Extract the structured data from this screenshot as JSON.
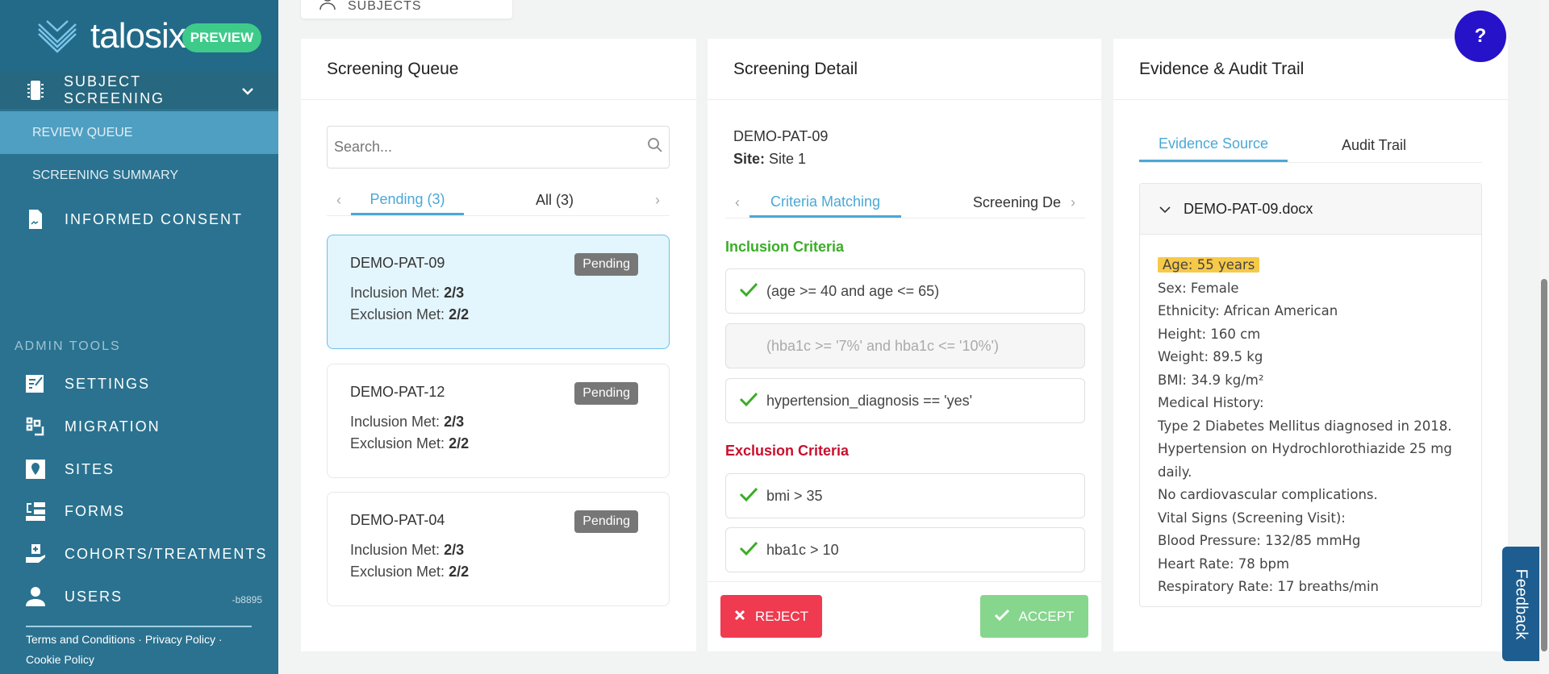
{
  "brand": {
    "name": "talosix",
    "badge": "PREVIEW"
  },
  "sidebar": {
    "subject_screening": "SUBJECT SCREENING",
    "sub_items": [
      "REVIEW QUEUE",
      "SCREENING SUMMARY"
    ],
    "informed_consent": "INFORMED CONSENT",
    "admin_title": "ADMIN TOOLS",
    "admin_items": [
      "SETTINGS",
      "MIGRATION",
      "SITES",
      "FORMS",
      "COHORTS/TREATMENTS",
      "USERS"
    ],
    "version": "-b8895",
    "footer": {
      "terms": "Terms and Conditions",
      "privacy": "Privacy Policy",
      "cookie": "Cookie Policy",
      "sep": "·"
    }
  },
  "top": {
    "bulk_import": "BULK IMPORT SUBJECTS"
  },
  "queue": {
    "title": "Screening Queue",
    "search_placeholder": "Search...",
    "tabs": [
      "Pending (3)",
      "All (3)"
    ],
    "cards": [
      {
        "id": "DEMO-PAT-09",
        "status": "Pending",
        "inclusion_label": "Inclusion Met:",
        "inclusion": "2/3",
        "exclusion_label": "Exclusion Met:",
        "exclusion": "2/2"
      },
      {
        "id": "DEMO-PAT-12",
        "status": "Pending",
        "inclusion_label": "Inclusion Met:",
        "inclusion": "2/3",
        "exclusion_label": "Exclusion Met:",
        "exclusion": "2/2"
      },
      {
        "id": "DEMO-PAT-04",
        "status": "Pending",
        "inclusion_label": "Inclusion Met:",
        "inclusion": "2/3",
        "exclusion_label": "Exclusion Met:",
        "exclusion": "2/2"
      }
    ]
  },
  "detail": {
    "title": "Screening Detail",
    "subject_id": "DEMO-PAT-09",
    "site_label": "Site:",
    "site": "Site 1",
    "tabs": [
      "Criteria Matching",
      "Screening De"
    ],
    "inclusion_title": "Inclusion Criteria",
    "inclusion": [
      {
        "text": "(age >= 40 and age <= 65)",
        "met": true
      },
      {
        "text": "(hba1c >= '7%' and hba1c <= '10%')",
        "met": false
      },
      {
        "text": "hypertension_diagnosis == 'yes'",
        "met": true
      }
    ],
    "exclusion_title": "Exclusion Criteria",
    "exclusion": [
      {
        "text": "bmi > 35",
        "met": true
      },
      {
        "text": "hba1c > 10",
        "met": true
      }
    ],
    "reject": "REJECT",
    "accept": "ACCEPT"
  },
  "evidence": {
    "title": "Evidence & Audit Trail",
    "tabs": [
      "Evidence Source",
      "Audit Trail"
    ],
    "file": "DEMO-PAT-09.docx",
    "highlight": "Age: 55 years",
    "lines": [
      "Sex: Female",
      "Ethnicity: African American",
      "Height: 160 cm",
      "Weight: 89.5 kg",
      "BMI: 34.9 kg/m²",
      "Medical History:",
      "Type 2 Diabetes Mellitus diagnosed in 2018.",
      "Hypertension on Hydrochlorothiazide 25 mg daily.",
      "No cardiovascular complications.",
      "Vital Signs (Screening Visit):",
      "Blood Pressure: 132/85 mmHg",
      "Heart Rate: 78 bpm",
      "Respiratory Rate: 17 breaths/min"
    ]
  },
  "help": "?",
  "feedback": "Feedback"
}
